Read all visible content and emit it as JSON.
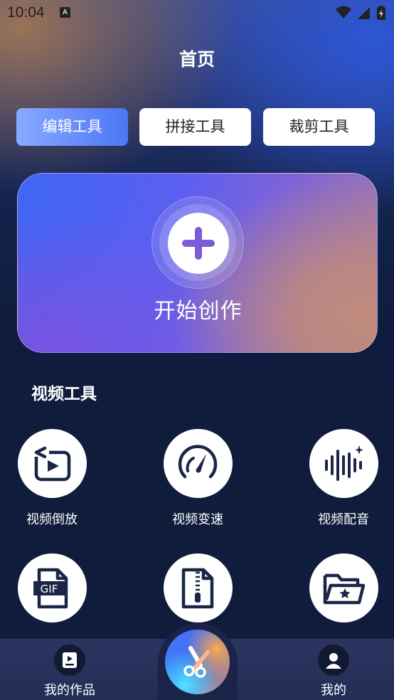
{
  "status_bar": {
    "time": "10:04",
    "notification_icon": "a-letter-icon",
    "icons": [
      "wifi-icon",
      "signal-icon",
      "battery-charging-icon"
    ]
  },
  "page": {
    "title": "首页"
  },
  "tabs": [
    {
      "label": "编辑工具",
      "active": true
    },
    {
      "label": "拼接工具",
      "active": false
    },
    {
      "label": "裁剪工具",
      "active": false
    }
  ],
  "create_card": {
    "label": "开始创作",
    "icon": "plus-icon"
  },
  "video_tools": {
    "title": "视频工具",
    "items": [
      {
        "label": "视频倒放",
        "icon": "reverse-play-icon"
      },
      {
        "label": "视频变速",
        "icon": "speedometer-icon"
      },
      {
        "label": "视频配音",
        "icon": "voice-wave-icon"
      },
      {
        "label": "",
        "icon": "gif-file-icon"
      },
      {
        "label": "",
        "icon": "zip-file-icon"
      },
      {
        "label": "",
        "icon": "folder-star-icon"
      }
    ]
  },
  "bottom_nav": {
    "left": {
      "label": "我的作品",
      "icon": "works-icon"
    },
    "center": {
      "icon": "scissors-icon"
    },
    "right": {
      "label": "我的",
      "icon": "user-icon"
    }
  },
  "colors": {
    "accent": "#4c76f5",
    "background": "#0f1c3b",
    "icon_dark": "#1b2647",
    "plus_purple": "#7b5bd6"
  }
}
